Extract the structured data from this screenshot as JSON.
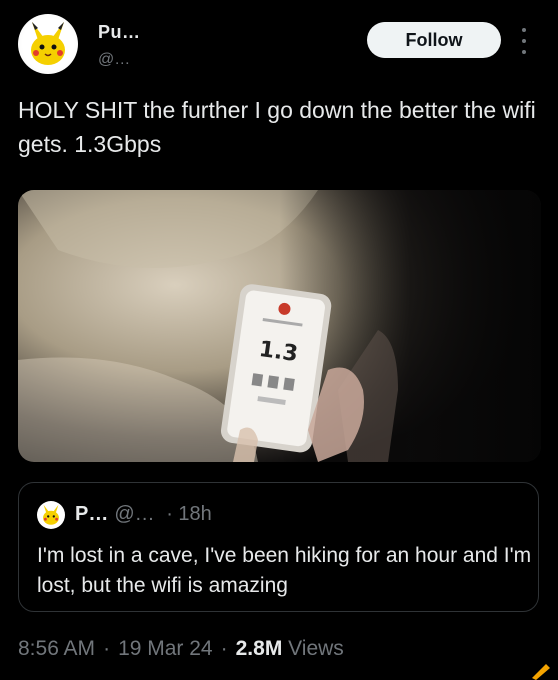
{
  "author": {
    "display_name": "Pu…",
    "handle": "@…",
    "avatar_icon": "pikachu-avatar-icon"
  },
  "follow_label": "Follow",
  "more_icon": "more-vertical-icon",
  "tweet": {
    "text": "HOLY SHIT the further I go down the better the wifi gets. 1.3Gbps"
  },
  "media": {
    "description_icon": "cave-photo-phone-speedtest",
    "phone_reading": "1.3"
  },
  "quoted": {
    "display_name": "P…",
    "handle": "@…",
    "time": "· 18h",
    "text": "I'm lost in a cave, I've been hiking for an hour and I'm lost, but the wifi is amazing"
  },
  "footer": {
    "time": "8:56 AM",
    "date": "19 Mar 24",
    "views_count": "2.8M",
    "views_label": "Views"
  },
  "colors": {
    "background": "#000000",
    "text": "#e7e9ea",
    "secondary": "#71767b",
    "border": "#2f3336",
    "follow_bg": "#eff3f4"
  }
}
